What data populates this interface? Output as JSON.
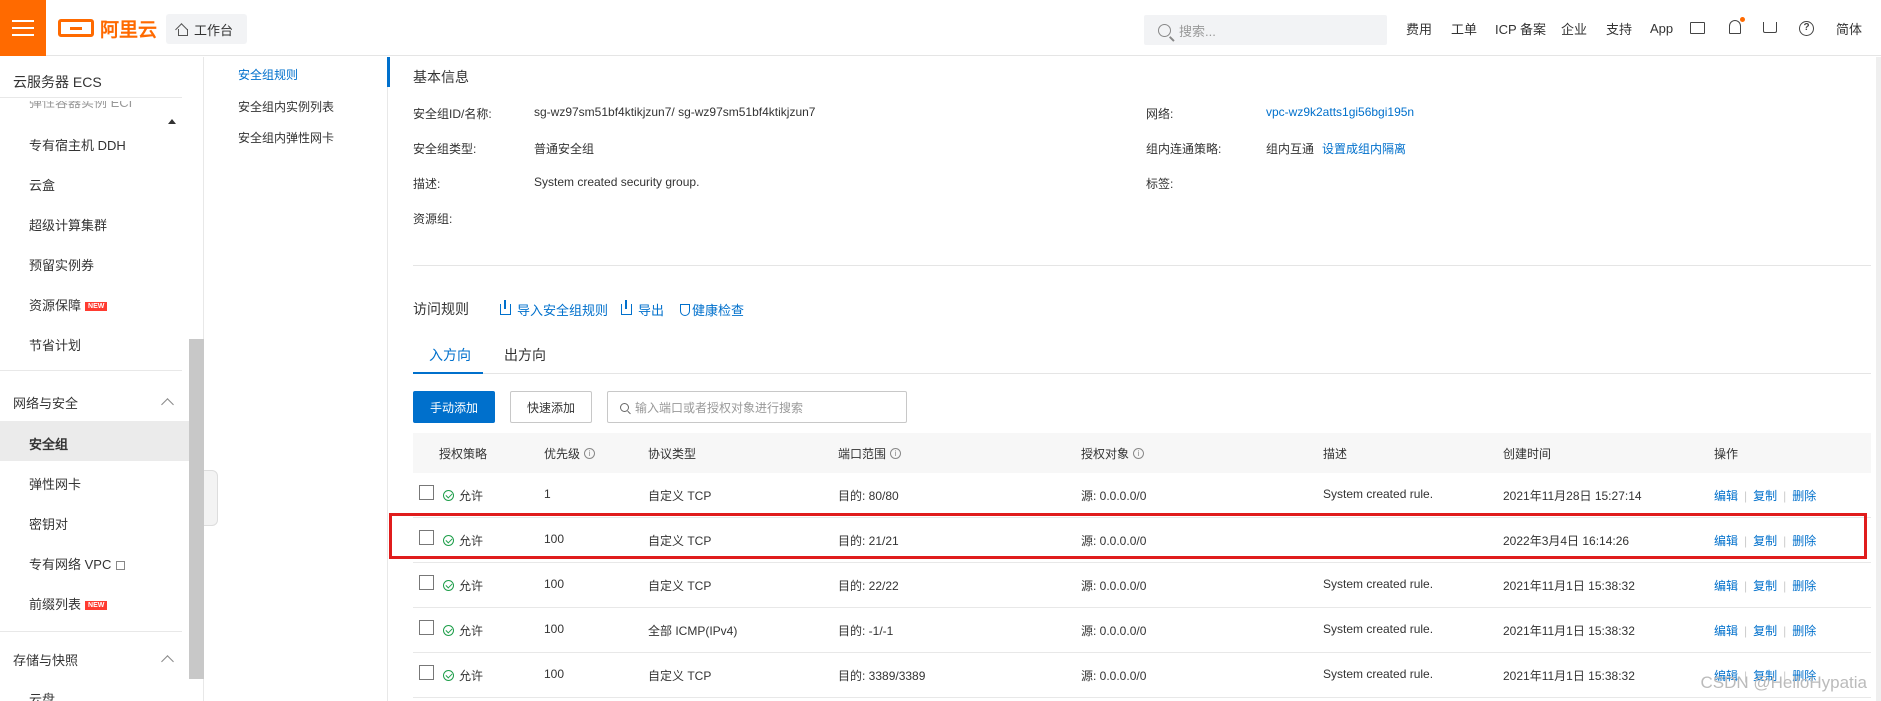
{
  "topbar": {
    "logo_text": "阿里云",
    "workbench_label": "工作台",
    "search_placeholder": "搜索...",
    "nav": [
      "费用",
      "工单",
      "ICP 备案",
      "企业",
      "支持",
      "App"
    ],
    "lang": "简体",
    "accent_color": "#ff6a00"
  },
  "sidebar": {
    "title": "云服务器 ECS",
    "truncated_item": "弹性容器实例 ECI",
    "items_top": [
      "专有宿主机 DDH",
      "云盒",
      "超级计算集群",
      "预留实例券",
      "资源保障",
      "节省计划"
    ],
    "new_badge": "NEW",
    "section_network": "网络与安全",
    "items_network": [
      "安全组",
      "弹性网卡",
      "密钥对",
      "专有网络 VPC",
      "前缀列表"
    ],
    "section_storage": "存储与快照",
    "items_storage": [
      "云盘"
    ]
  },
  "subnav": {
    "items": [
      "安全组规则",
      "安全组内实例列表",
      "安全组内弹性网卡"
    ]
  },
  "basic_info": {
    "title": "基本信息",
    "id_label": "安全组ID/名称:",
    "id_value": "sg-wz97sm51bf4ktikjzun7/ sg-wz97sm51bf4ktikjzun7",
    "type_label": "安全组类型:",
    "type_value": "普通安全组",
    "desc_label": "描述:",
    "desc_value": "System created security group.",
    "rg_label": "资源组:",
    "network_label": "网络:",
    "network_value": "vpc-wz9k2atts1gi56bgi195n",
    "policy_label": "组内连通策略:",
    "policy_value": "组内互通",
    "policy_link": "设置成组内隔离",
    "tag_label": "标签:"
  },
  "access_rules": {
    "title": "访问规则",
    "import_link": "导入安全组规则",
    "export_link": "导出",
    "health_link": "健康检查",
    "tabs": [
      "入方向",
      "出方向"
    ],
    "btn_manual": "手动添加",
    "btn_quick": "快速添加",
    "search_placeholder": "输入端口或者授权对象进行搜索",
    "columns": [
      "授权策略",
      "优先级",
      "协议类型",
      "端口范围",
      "授权对象",
      "描述",
      "创建时间",
      "操作"
    ],
    "rows": [
      {
        "policy": "允许",
        "priority": "1",
        "protocol": "自定义 TCP",
        "port": "目的: 80/80",
        "source": "源: 0.0.0.0/0",
        "desc": "System created rule.",
        "time": "2021年11月28日 15:27:14"
      },
      {
        "policy": "允许",
        "priority": "100",
        "protocol": "自定义 TCP",
        "port": "目的: 21/21",
        "source": "源: 0.0.0.0/0",
        "desc": "",
        "time": "2022年3月4日 16:14:26"
      },
      {
        "policy": "允许",
        "priority": "100",
        "protocol": "自定义 TCP",
        "port": "目的: 22/22",
        "source": "源: 0.0.0.0/0",
        "desc": "System created rule.",
        "time": "2021年11月1日 15:38:32"
      },
      {
        "policy": "允许",
        "priority": "100",
        "protocol": "全部 ICMP(IPv4)",
        "port": "目的: -1/-1",
        "source": "源: 0.0.0.0/0",
        "desc": "System created rule.",
        "time": "2021年11月1日 15:38:32"
      },
      {
        "policy": "允许",
        "priority": "100",
        "protocol": "自定义 TCP",
        "port": "目的: 3389/3389",
        "source": "源: 0.0.0.0/0",
        "desc": "System created rule.",
        "time": "2021年11月1日 15:38:32"
      }
    ],
    "ops": [
      "编辑",
      "复制",
      "删除"
    ]
  },
  "watermark": "CSDN @HelloHypatia"
}
